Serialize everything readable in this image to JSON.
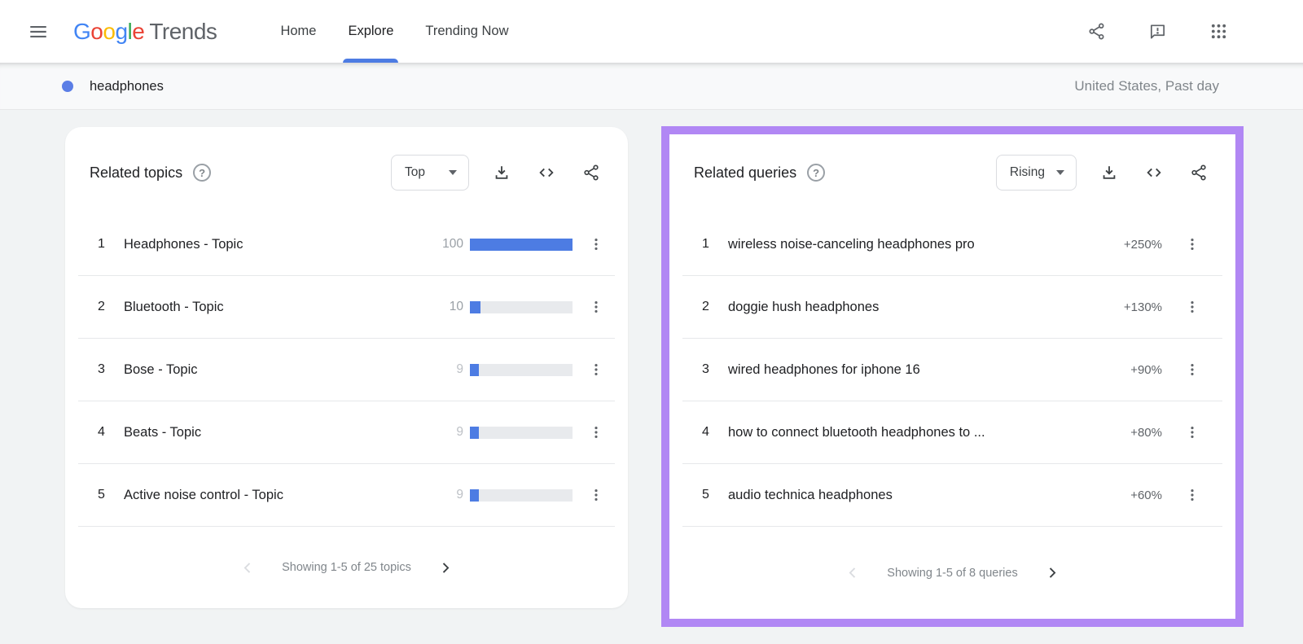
{
  "header": {
    "logo": {
      "letters": [
        {
          "ch": "G",
          "color": "#4285F4"
        },
        {
          "ch": "o",
          "color": "#EA4335"
        },
        {
          "ch": "o",
          "color": "#FBBC05"
        },
        {
          "ch": "g",
          "color": "#4285F4"
        },
        {
          "ch": "l",
          "color": "#34A853"
        },
        {
          "ch": "e",
          "color": "#EA4335"
        }
      ],
      "suffix": "Trends"
    },
    "nav": [
      {
        "label": "Home",
        "active": false
      },
      {
        "label": "Explore",
        "active": true
      },
      {
        "label": "Trending Now",
        "active": false
      }
    ],
    "action_icons": [
      "share-icon",
      "feedback-icon",
      "apps-grid-icon"
    ]
  },
  "term_bar": {
    "term": "headphones",
    "dot_color": "#5b7ee6",
    "filters": "United States, Past day"
  },
  "related_topics": {
    "title": "Related topics",
    "sort": "Top",
    "rows": [
      {
        "rank": "1",
        "label": "Headphones - Topic",
        "value": "100",
        "bar_pct": 100
      },
      {
        "rank": "2",
        "label": "Bluetooth - Topic",
        "value": "10",
        "bar_pct": 10
      },
      {
        "rank": "3",
        "label": "Bose - Topic",
        "value": "9",
        "bar_pct": 9
      },
      {
        "rank": "4",
        "label": "Beats - Topic",
        "value": "9",
        "bar_pct": 9
      },
      {
        "rank": "5",
        "label": "Active noise control - Topic",
        "value": "9",
        "bar_pct": 9
      }
    ],
    "pagination": {
      "text": "Showing 1-5 of 25 topics",
      "prev_enabled": false,
      "next_enabled": true
    }
  },
  "related_queries": {
    "title": "Related queries",
    "sort": "Rising",
    "highlight_color": "#b187f4",
    "rows": [
      {
        "rank": "1",
        "label": "wireless noise-canceling headphones pro",
        "value": "+250%"
      },
      {
        "rank": "2",
        "label": "doggie hush headphones",
        "value": "+130%"
      },
      {
        "rank": "3",
        "label": "wired headphones for iphone 16",
        "value": "+90%"
      },
      {
        "rank": "4",
        "label": "how to connect bluetooth headphones to ...",
        "value": "+80%"
      },
      {
        "rank": "5",
        "label": "audio technica headphones",
        "value": "+60%"
      }
    ],
    "pagination": {
      "text": "Showing 1-5 of 8 queries",
      "prev_enabled": false,
      "next_enabled": true
    }
  },
  "colors": {
    "bar_blue": "#4d7ce3",
    "active_tab_blue": "#4d7ce3",
    "highlight_purple": "#b187f4",
    "page_bg": "#f1f3f4",
    "term_bar_bg": "#f8f9fa"
  }
}
